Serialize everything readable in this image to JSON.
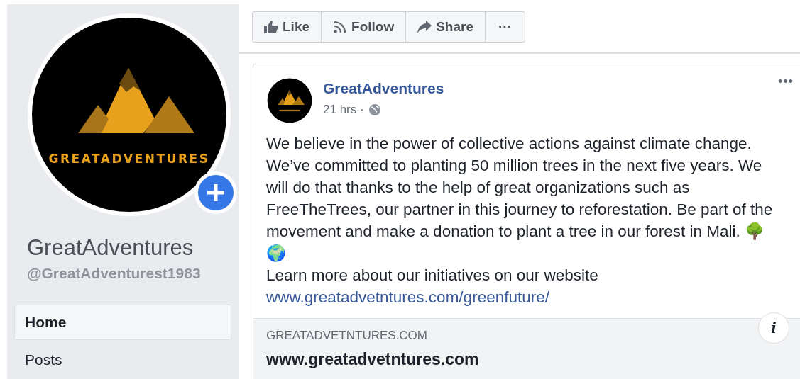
{
  "profile": {
    "logo_text": "GREATADVENTURES",
    "name": "GreatAdventures",
    "handle": "@GreatAdventurest1983"
  },
  "nav": [
    {
      "label": "Home",
      "selected": true
    },
    {
      "label": "Posts",
      "selected": false
    }
  ],
  "actions": [
    {
      "kind": "like",
      "label": "Like"
    },
    {
      "kind": "follow",
      "label": "Follow"
    },
    {
      "kind": "share",
      "label": "Share"
    },
    {
      "kind": "more",
      "label": "···"
    }
  ],
  "post": {
    "author": "GreatAdventures",
    "time": "21 hrs ·",
    "more": "•••",
    "body": "We believe in the power of collective actions against climate change. We’ve committed to planting 50 million trees in the next five years. We will do that thanks to the help of great organizations such as FreeTheTrees, our partner in this journey to reforestation. Be part of the movement and make a donation to plant a tree in our forest in Mali. 🌳",
    "globe": "🌍",
    "learn_more": "Learn more about our initiatives on our website",
    "link": "www.greatadvetntures.com/greenfuture/",
    "preview": {
      "domain": "GREATADVETNTURES.COM",
      "title": "www.greatadvetntures.com",
      "info": "i"
    }
  }
}
